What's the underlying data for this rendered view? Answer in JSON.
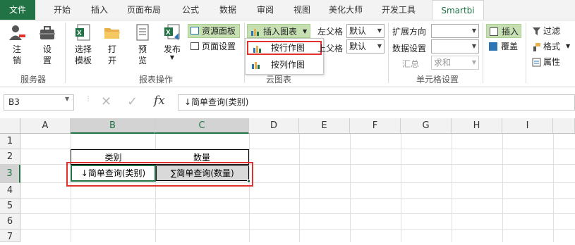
{
  "tabs": [
    "文件",
    "开始",
    "插入",
    "页面布局",
    "公式",
    "数据",
    "审阅",
    "视图",
    "美化大师",
    "开发工具",
    "Smartbi"
  ],
  "ribbon": {
    "logout": "注\n销",
    "settings": "设\n置",
    "service_group": "服务器",
    "choose_template": "选择\n模板",
    "open": "打\n开",
    "preview": "预\n览",
    "publish": "发布",
    "report_group": "报表操作",
    "resource_panel": "资源面板",
    "page_setup": "页面设置",
    "insert_chart": "插入图表",
    "by_row": "按行作图",
    "by_col": "按列作图",
    "cloud_group": "云图表",
    "left_parent_label": "左父格",
    "left_parent_value": "默认",
    "top_parent_label": "上父格",
    "top_parent_value": "默认",
    "expand_label": "扩展方向",
    "data_setting_label": "数据设置",
    "summary_label": "汇总",
    "summary_value": "求和",
    "cell_setting_group": "单元格设置",
    "insert": "插入",
    "overwrite": "覆盖",
    "filter": "过滤",
    "format": "格式",
    "attribute": "属性"
  },
  "formula": {
    "namebox": "B3",
    "content": "↓简单查询(类别)"
  },
  "columns": [
    "A",
    "B",
    "C",
    "D",
    "E",
    "F",
    "G",
    "H",
    "I"
  ],
  "rows": [
    "1",
    "2",
    "3",
    "4",
    "5",
    "6",
    "7"
  ],
  "cells": {
    "b2": "类别",
    "c2": "数量",
    "b3": "↓简单查询(类别)",
    "c3": "∑简单查询(数量)"
  },
  "colors": {
    "accent": "#217346",
    "highlight": "#e03030"
  }
}
